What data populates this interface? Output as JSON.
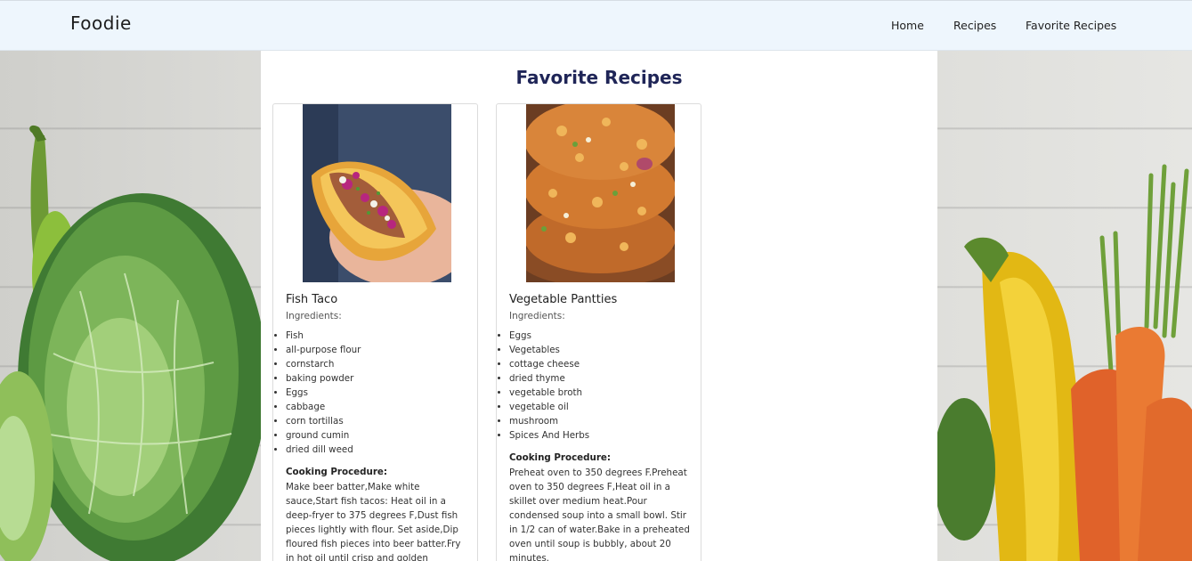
{
  "navbar": {
    "brand": "Foodie",
    "links": [
      "Home",
      "Recipes",
      "Favorite Recipes"
    ]
  },
  "main": {
    "title": "Favorite Recipes",
    "cards": [
      {
        "title": "Fish Taco",
        "ingredients_label": "Ingredients:",
        "ingredients": [
          "Fish",
          "all-purpose flour",
          "cornstarch",
          "baking powder",
          "Eggs",
          "cabbage",
          "corn tortillas",
          "ground cumin",
          "dried dill weed"
        ],
        "procedure_label": "Cooking Procedure:",
        "procedure": "Make beer batter,Make white sauce,Start fish tacos: Heat oil in a deep-fryer to 375 degrees F,Dust fish pieces lightly with flour. Set aside,Dip floured fish pieces into beer batter.Fry in hot oil until crisp and golden"
      },
      {
        "title": "Vegetable Pantties",
        "ingredients_label": "Ingredients:",
        "ingredients": [
          "Eggs",
          "Vegetables",
          "cottage cheese",
          "dried thyme",
          "vegetable broth",
          "vegetable oil",
          "mushroom",
          "Spices And Herbs"
        ],
        "procedure_label": "Cooking Procedure:",
        "procedure": "Preheat oven to 350 degrees F.Preheat oven to 350 degrees F,Heat oil in a skillet over medium heat.Pour condensed soup into a small bowl. Stir in 1/2 can of water.Bake in a preheated oven until soup is bubbly, about 20 minutes."
      }
    ]
  }
}
